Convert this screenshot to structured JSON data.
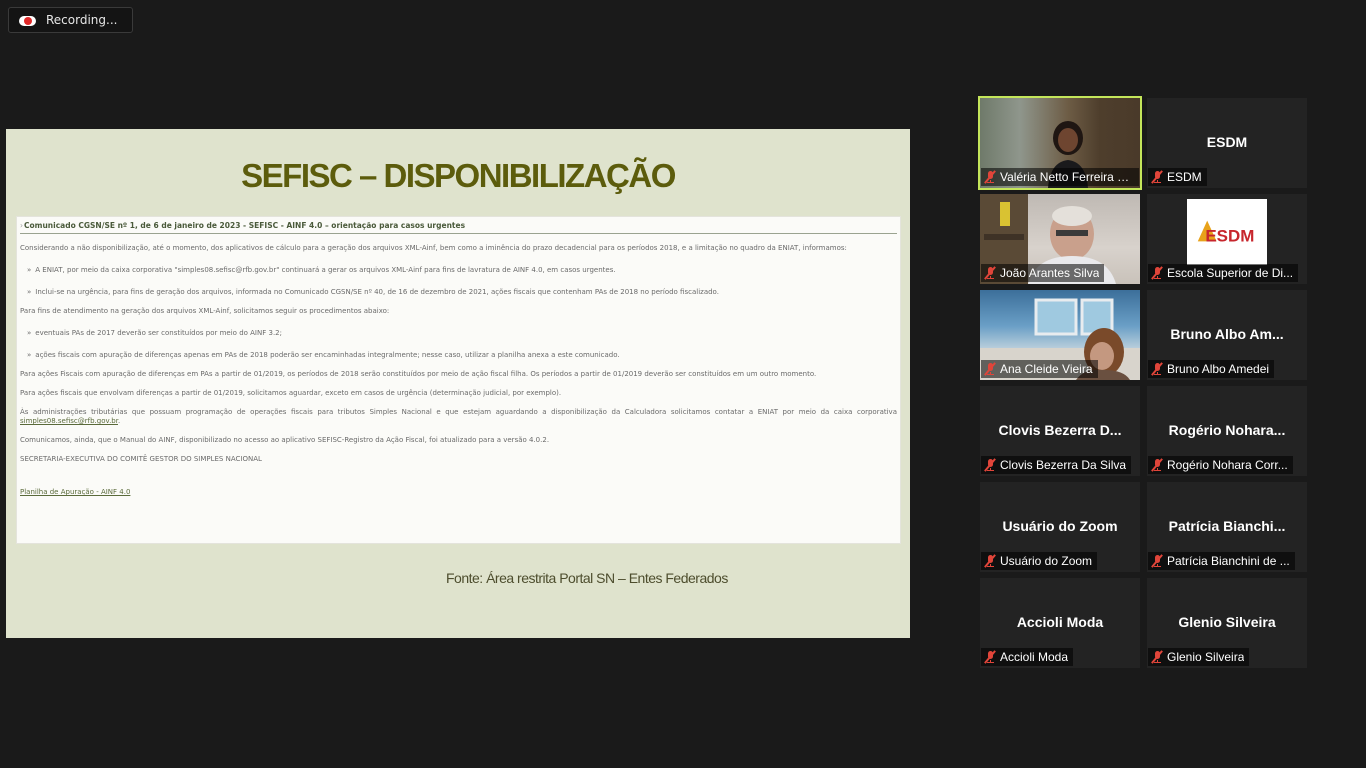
{
  "recording": {
    "label": "Recording..."
  },
  "slide": {
    "title": "SEFISC – DISPONIBILIZAÇÃO",
    "source": "Fonte:  Área restrita Portal SN – Entes Federados",
    "doc": {
      "heading_bullet": "›",
      "heading": "Comunicado CGSN/SE nº 1, de 6 de janeiro de 2023 - SEFISC - AINF 4.0 – orientação para casos urgentes",
      "p1": "Considerando a não disponibilização, até o momento, dos aplicativos de cálculo para a geração dos arquivos XML-Ainf, bem como a iminência do prazo decadencial para os períodos 2018, e a limitação no quadro da ENIAT, informamos:",
      "li1": "A ENIAT, por meio da caixa corporativa \"simples08.sefisc@rfb.gov.br\" continuará a gerar os arquivos XML-Ainf para fins de lavratura de AINF 4.0, em casos urgentes.",
      "li2": "Inclui-se na urgência, para fins de geração dos arquivos, informada no Comunicado CGSN/SE nº 40, de 16 de dezembro de 2021, ações fiscais que contenham PAs de 2018 no período fiscalizado.",
      "p2": "Para fins de atendimento na geração dos arquivos XML-Ainf, solicitamos seguir os procedimentos abaixo:",
      "li3": "eventuais PAs de 2017 deverão ser constituídos por meio do AINF 3.2;",
      "li4": "ações fiscais com apuração de diferenças apenas em PAs de 2018 poderão ser encaminhadas integralmente; nesse caso, utilizar a planilha anexa a este comunicado.",
      "p3": "Para ações Fiscais com apuração de diferenças em PAs a partir de 01/2019, os períodos de 2018 serão constituídos por meio de ação fiscal filha. Os períodos a partir de 01/2019 deverão ser constituídos em um outro momento.",
      "p4": "Para ações fiscais que envolvam diferenças a partir de 01/2019, solicitamos aguardar, exceto em casos de urgência (determinação judicial, por exemplo).",
      "p5": "Às administrações tributárias que possuam programação de operações fiscais para tributos Simples Nacional e que estejam aguardando a disponibilização da Calculadora solicitamos contatar a ENIAT por meio da caixa corporativa",
      "p5_link": "simples08.sefisc@rfb.gov.br",
      "p5_end": ".",
      "p6": "Comunicamos, ainda, que o Manual do AINF, disponibilizado no acesso ao aplicativo SEFISC-Registro da Ação Fiscal, foi atualizado para a versão 4.0.2.",
      "p7": "SECRETARIA-EXECUTIVA DO COMITÊ GESTOR DO SIMPLES NACIONAL",
      "link": "Planilha de Apuração - AINF 4.0"
    }
  },
  "participants": [
    {
      "name": "",
      "label": "Valéria Netto Ferreira C...",
      "video": "v1"
    },
    {
      "name": "ESDM",
      "label": "ESDM"
    },
    {
      "name": "",
      "label": "João Arantes Silva",
      "video": "v2"
    },
    {
      "name": "",
      "label": "Escola Superior de Di...",
      "logo": "ESDM"
    },
    {
      "name": "",
      "label": "Ana Cleide Vieira",
      "video": "v3"
    },
    {
      "name": "Bruno Albo Am...",
      "label": "Bruno Albo Amedei"
    },
    {
      "name": "Clovis  Bezerra  D...",
      "label": "Clovis Bezerra Da Silva"
    },
    {
      "name": "Rogério  Nohara...",
      "label": "Rogério Nohara Corr..."
    },
    {
      "name": "Usuário do Zoom",
      "label": "Usuário do Zoom"
    },
    {
      "name": "Patrícia  Bianchi...",
      "label": "Patrícia Bianchini de ..."
    },
    {
      "name": "Accioli Moda",
      "label": "Accioli Moda"
    },
    {
      "name": "Glenio Silveira",
      "label": "Glenio Silveira"
    }
  ],
  "colors": {
    "active_speaker": "#c4e65a",
    "muted_mic": "#e0453a",
    "slide_title": "#5c5c0c"
  },
  "icons": {
    "recording": "cloud-record-icon",
    "mic": "mic-muted-icon"
  }
}
